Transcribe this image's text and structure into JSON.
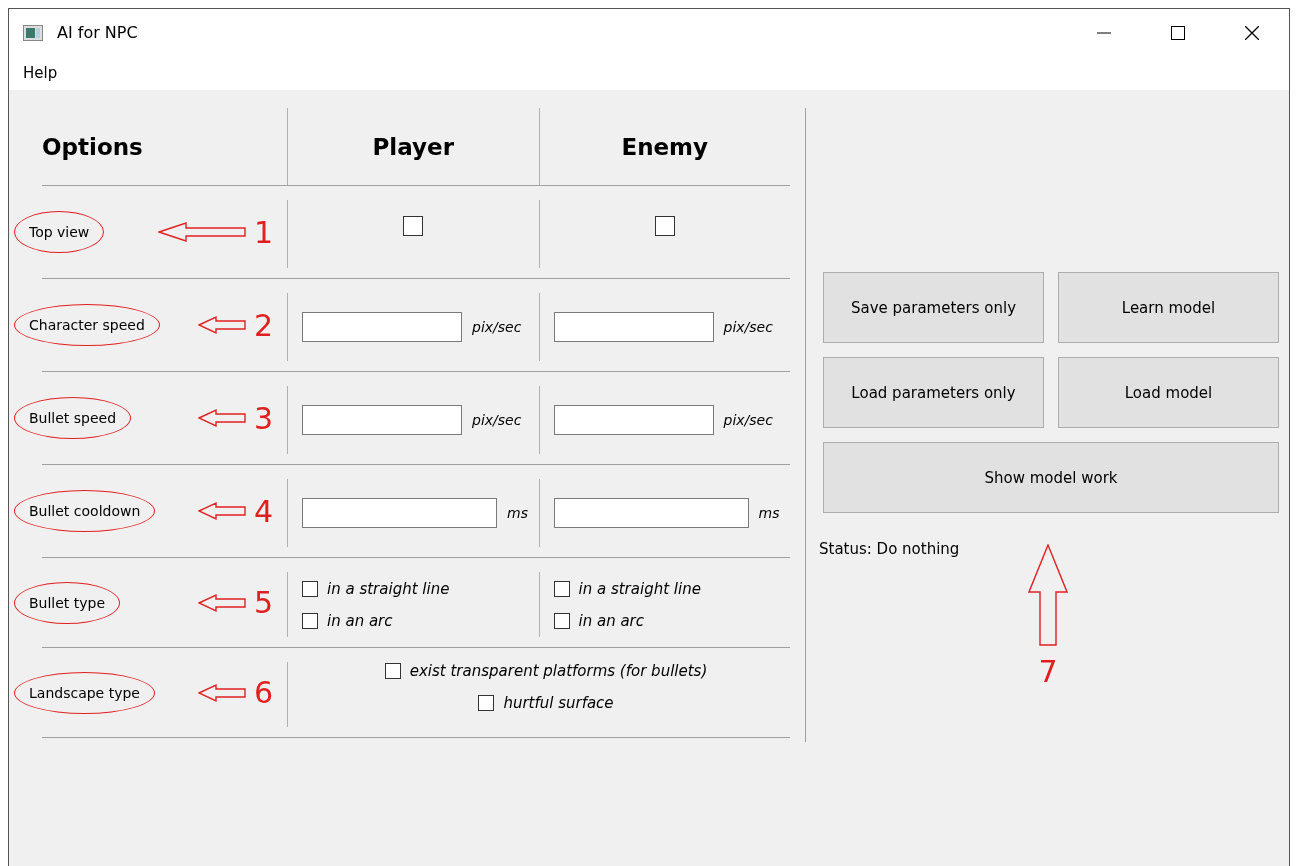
{
  "window": {
    "title": "AI for NPC"
  },
  "menu": [
    "Help"
  ],
  "columns": [
    "Options",
    "Player",
    "Enemy"
  ],
  "rows": [
    {
      "label": "Top view",
      "annotation": "1",
      "kind": "checkbox",
      "player": {
        "checked": false
      },
      "enemy": {
        "checked": false
      }
    },
    {
      "label": "Character speed",
      "annotation": "2",
      "kind": "field",
      "player": {
        "unit": "pix/sec"
      },
      "enemy": {
        "unit": "pix/sec"
      }
    },
    {
      "label": "Bullet speed",
      "annotation": "3",
      "kind": "field",
      "player": {
        "unit": "pix/sec"
      },
      "enemy": {
        "unit": "pix/sec"
      }
    },
    {
      "label": "Bullet cooldown",
      "annotation": "4",
      "kind": "field",
      "player": {
        "unit": "ms"
      },
      "enemy": {
        "unit": "ms"
      }
    },
    {
      "label": "Bullet type",
      "annotation": "5",
      "kind": "choices",
      "player": {
        "options": [
          {
            "label": "in a straight line",
            "checked": false
          },
          {
            "label": "in an arc",
            "checked": false
          }
        ]
      },
      "enemy": {
        "options": [
          {
            "label": "in a straight line",
            "checked": false
          },
          {
            "label": "in an arc",
            "checked": false
          }
        ]
      }
    },
    {
      "label": "Landscape type",
      "annotation": "6",
      "kind": "span",
      "options": [
        {
          "label": "exist transparent platforms (for bullets)",
          "checked": false
        },
        {
          "label": "hurtful surface",
          "checked": false
        }
      ]
    }
  ],
  "buttons": [
    [
      "Save parameters only",
      "Learn model"
    ],
    [
      "Load parameters only",
      "Load model"
    ],
    [
      "Show model work"
    ]
  ],
  "status": "Status: Do nothing",
  "status_annotation": "7"
}
